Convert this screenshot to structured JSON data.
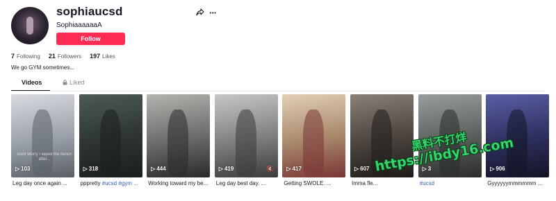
{
  "profile": {
    "username": "sophiaucsd",
    "nickname": "SophiaaaaaaA",
    "follow_label": "Follow",
    "bio": "We go GYM sometimes..."
  },
  "stats": {
    "following": "7",
    "following_label": "Following",
    "followers": "21",
    "followers_label": "Followers",
    "likes": "197",
    "likes_label": "Likes"
  },
  "tabs": {
    "videos": "Videos",
    "liked": "Liked"
  },
  "videos": [
    {
      "views": "103",
      "caption": "Leg day once again ...",
      "overlay": "Dont Worry I wiped the bench after...",
      "colors": [
        "#d9dbe0",
        "#9aa0a8",
        "#5a5f66"
      ]
    },
    {
      "views": "318",
      "caption_text": "pppretty ",
      "caption_tags": "#ucsd #gym ...",
      "colors": [
        "#4d5a55",
        "#2d3431",
        "#1b1f1d"
      ]
    },
    {
      "views": "444",
      "caption": "Working toward my be...",
      "colors": [
        "#b5b3b0",
        "#6c6a68",
        "#2a2a2c"
      ]
    },
    {
      "views": "419",
      "caption": "Leg day best day. ...",
      "colors": [
        "#c6c7c9",
        "#7d7e80",
        "#3a3b3d"
      ]
    },
    {
      "views": "417",
      "caption": "Getting SWOLE. ...",
      "colors": [
        "#e2d0b6",
        "#a7866a",
        "#7a3535"
      ]
    },
    {
      "views": "607",
      "caption": "Imma fle...",
      "colors": [
        "#8a8078",
        "#4a433e",
        "#1f1c1a"
      ]
    },
    {
      "views": "3",
      "caption_text": "",
      "caption_tags": "#ucsd",
      "colors": [
        "#9a9e9a",
        "#5b5f5b",
        "#2a2d2a"
      ]
    },
    {
      "views": "906",
      "caption": "Gyyyyyymmmmmm ...",
      "colors": [
        "#5a5fa6",
        "#2e2f5e",
        "#131424"
      ]
    }
  ],
  "watermark": {
    "line1": "黑料不打烊",
    "line2": "https://ibdy16.com"
  },
  "colors": {
    "accent": "#fe2c55",
    "tag": "#2b5db9"
  }
}
